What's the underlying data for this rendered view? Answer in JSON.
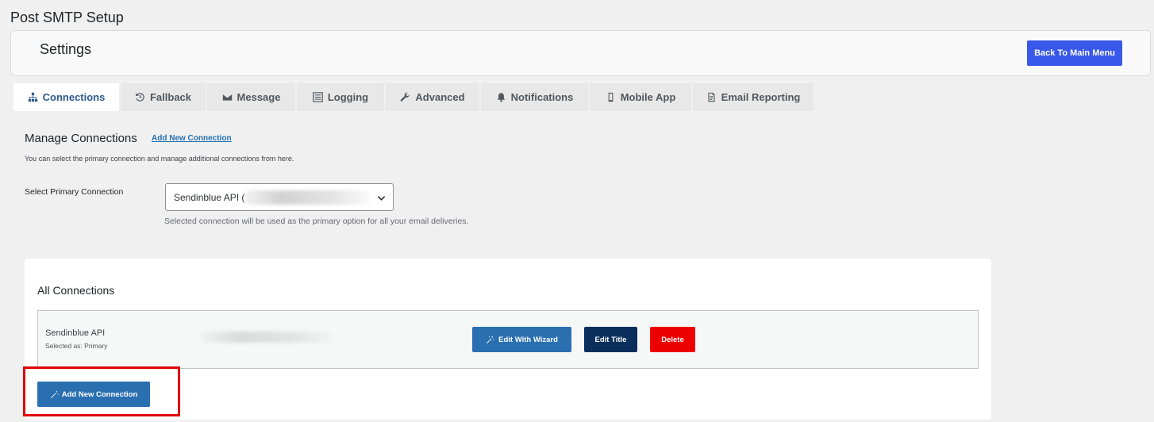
{
  "page": {
    "title": "Post SMTP Setup"
  },
  "settings_bar": {
    "title": "Settings",
    "back_button": "Back To Main Menu"
  },
  "tabs": [
    {
      "label": "Connections",
      "icon": "sitemap-icon",
      "active": true
    },
    {
      "label": "Fallback",
      "icon": "history-icon",
      "active": false
    },
    {
      "label": "Message",
      "icon": "envelope-icon",
      "active": false
    },
    {
      "label": "Logging",
      "icon": "list-icon",
      "active": false
    },
    {
      "label": "Advanced",
      "icon": "wrench-icon",
      "active": false
    },
    {
      "label": "Notifications",
      "icon": "bell-icon",
      "active": false
    },
    {
      "label": "Mobile App",
      "icon": "mobile-icon",
      "active": false
    },
    {
      "label": "Email Reporting",
      "icon": "report-icon",
      "active": false
    }
  ],
  "manage": {
    "title": "Manage Connections",
    "add_link": "Add New Connection",
    "description": "You can select the primary connection and manage additional connections from here."
  },
  "primary": {
    "label": "Select Primary Connection",
    "selected": "Sendinblue API (",
    "help": "Selected connection will be used as the primary option for all your email deliveries."
  },
  "all_connections": {
    "title": "All Connections",
    "rows": [
      {
        "name": "Sendinblue API",
        "selected_as": "Selected as: Primary"
      }
    ],
    "buttons": {
      "wizard": "Edit With Wizard",
      "edit_title": "Edit Title",
      "delete": "Delete"
    },
    "add_button": "Add New Connection"
  },
  "colors": {
    "accent_blue": "#3858e9",
    "button_blue": "#2a6fb0",
    "navy": "#0b2f5c",
    "delete_red": "#ee0000",
    "highlight_red": "#e00000"
  }
}
